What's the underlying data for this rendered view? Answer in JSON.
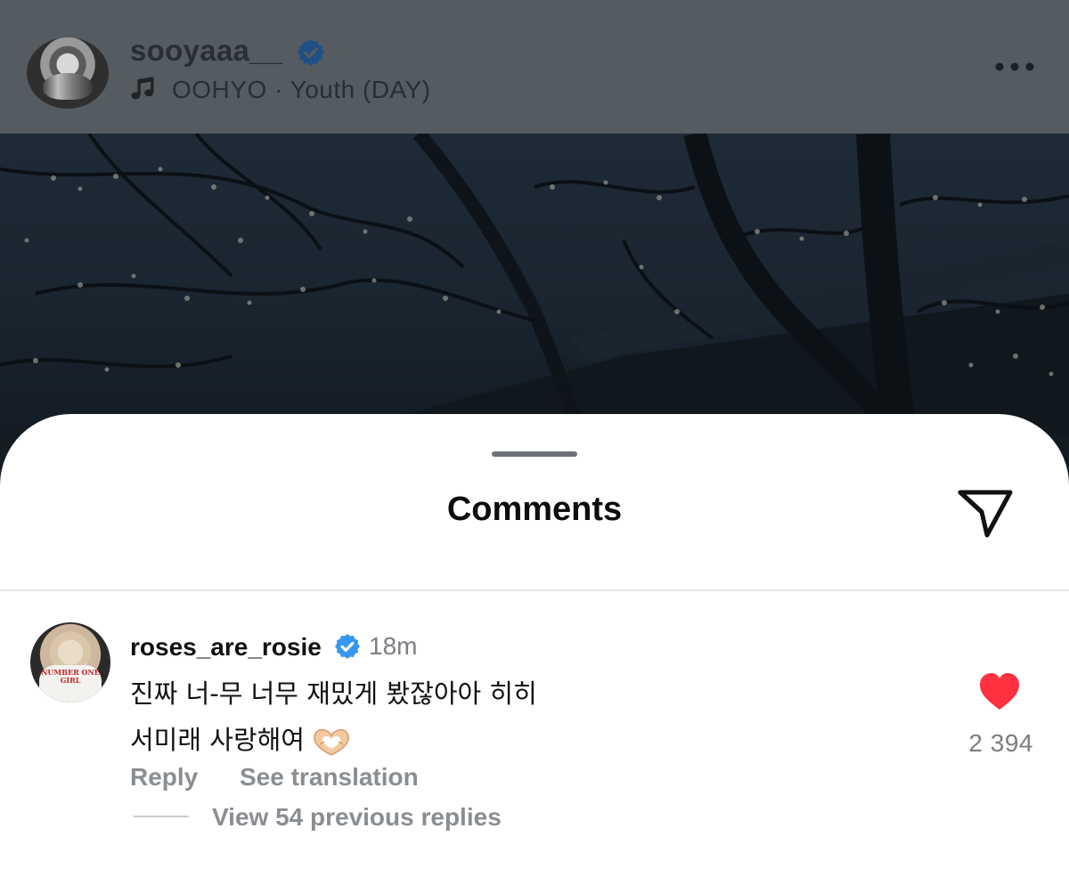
{
  "post": {
    "username": "sooyaaa__",
    "music_text": "OOHYO · Youth (DAY)",
    "icons": [
      "verified-badge-icon",
      "music-note-icon",
      "more-options-icon"
    ]
  },
  "comments_sheet": {
    "title": "Comments",
    "share_icon": "paper-plane-icon"
  },
  "comment": {
    "username": "roses_are_rosie",
    "time": "18m",
    "text_line1": "진짜 너-무 너무 재밌게 봤잖아아 히히",
    "text_line2": "서미래 사랑해여",
    "emoji": "heart-hands-emoji",
    "like_count": "2 394",
    "reply_label": "Reply",
    "see_translation_label": "See translation",
    "view_replies_label": "View 54 previous replies",
    "avatar_shirt_text": "NUMBER ONE GIRL"
  },
  "colors": {
    "verified": "#3797f0",
    "like": "#ff3040",
    "header_dim": "#545b61"
  }
}
